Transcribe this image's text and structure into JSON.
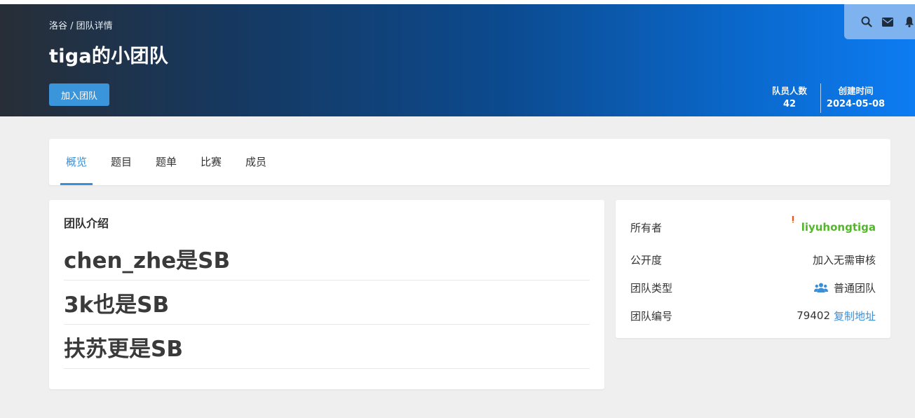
{
  "header": {
    "breadcrumb": "洛谷 / 团队详情",
    "title": "tiga的小团队",
    "join_label": "加入团队",
    "stats": [
      {
        "label": "队员人数",
        "value": "42"
      },
      {
        "label": "创建时间",
        "value": "2024-05-08"
      }
    ]
  },
  "toolbar": {
    "icons": [
      "search-icon",
      "mail-icon",
      "bell-icon"
    ]
  },
  "tabs": [
    {
      "label": "概览",
      "active": true
    },
    {
      "label": "题目",
      "active": false
    },
    {
      "label": "题单",
      "active": false
    },
    {
      "label": "比赛",
      "active": false
    },
    {
      "label": "成员",
      "active": false
    }
  ],
  "intro": {
    "title": "团队介绍",
    "lines": [
      "chen_zhe是SB",
      "3k也是SB",
      "扶苏更是SB"
    ]
  },
  "info": {
    "owner_label": "所有者",
    "owner_name": "liyuhongtiga",
    "visibility_label": "公开度",
    "visibility_value": "加入无需审核",
    "type_label": "团队类型",
    "type_value": "普通团队",
    "id_label": "团队编号",
    "id_value": "79402",
    "copy_label": "复制地址"
  },
  "colors": {
    "accent": "#3a8fd6",
    "owner_name": "#52b829",
    "join_button": "#3a95da"
  }
}
